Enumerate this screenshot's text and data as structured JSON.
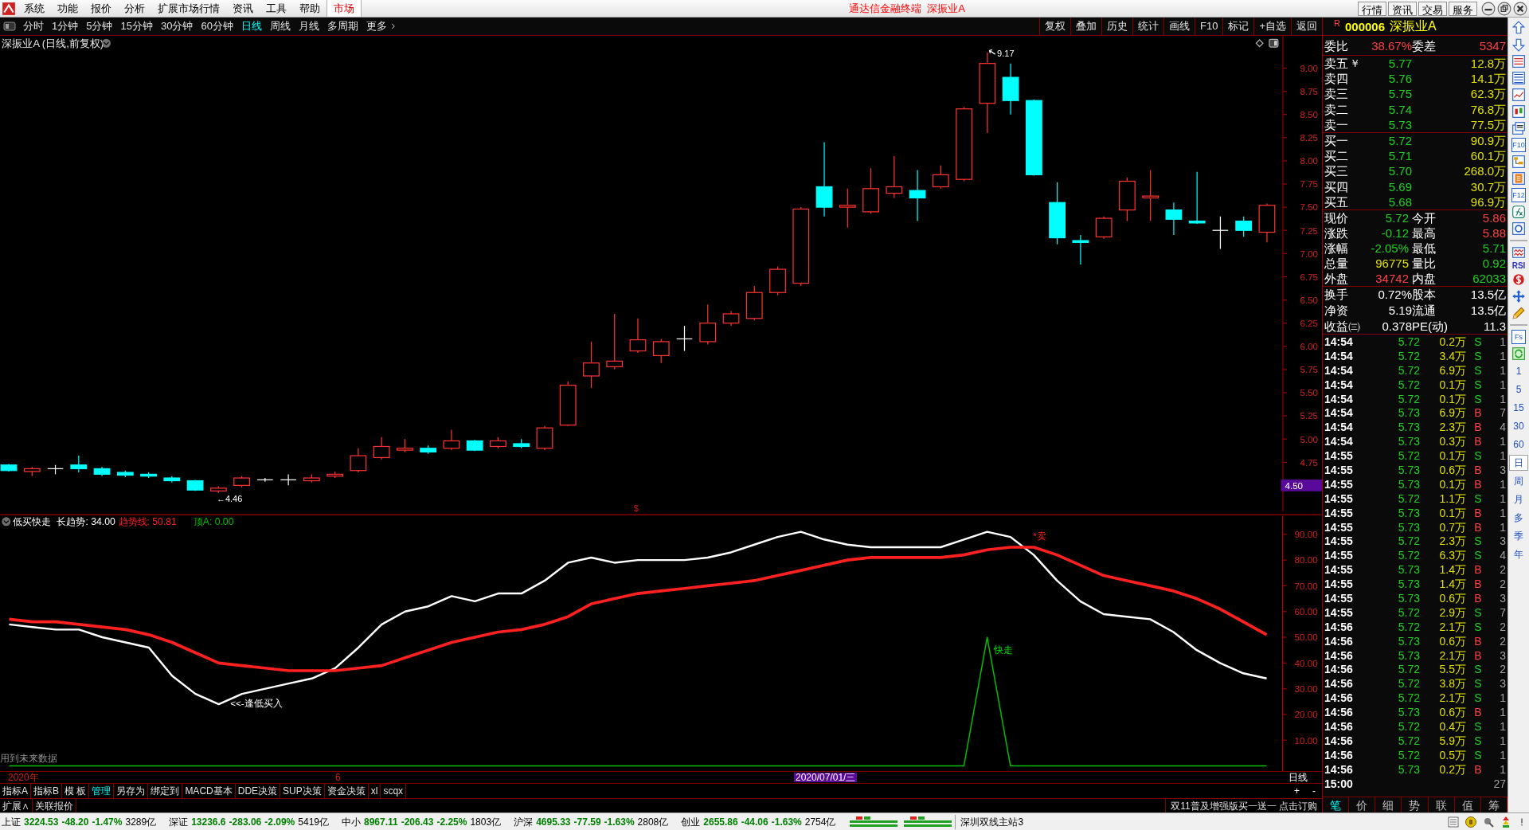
{
  "title_bar": {
    "menu": [
      "系统",
      "功能",
      "报价",
      "分析",
      "扩展市场行情",
      "资讯",
      "工具",
      "帮助"
    ],
    "market_tab": "市场",
    "title": "通达信金融终端  深振业A",
    "buttons": [
      "行情",
      "资讯",
      "交易",
      "服务"
    ]
  },
  "period_tabs": [
    {
      "label": "分时",
      "selected": false
    },
    {
      "label": "1分钟",
      "selected": false
    },
    {
      "label": "5分钟",
      "selected": false
    },
    {
      "label": "15分钟",
      "selected": false
    },
    {
      "label": "30分钟",
      "selected": false
    },
    {
      "label": "60分钟",
      "selected": false
    },
    {
      "label": "日线",
      "selected": true
    },
    {
      "label": "周线",
      "selected": false
    },
    {
      "label": "月线",
      "selected": false
    },
    {
      "label": "多周期",
      "selected": false
    },
    {
      "label": "更多",
      "selected": false
    }
  ],
  "chart_tools": [
    "复权",
    "叠加",
    "历史",
    "统计",
    "画线",
    "F10",
    "标记",
    "+自选",
    "返回"
  ],
  "price_chart": {
    "title": "深振业A (日线,前复权)",
    "y_labels": [
      "9.00",
      "8.75",
      "8.50",
      "8.25",
      "8.00",
      "7.75",
      "7.50",
      "7.25",
      "7.00",
      "6.75",
      "6.50",
      "6.25",
      "6.00",
      "5.75",
      "5.50",
      "5.25",
      "5.00",
      "4.75"
    ],
    "price_marker": "4.50",
    "high_label": "9.17",
    "low_label": "←4.46",
    "signal_mark": "$"
  },
  "indicator": {
    "name": "低买快走",
    "buy_label": "<<-逢低买入",
    "sell_label": "*卖",
    "exit_label": "快走",
    "footnote": "用到未来数据",
    "chart_data": {
      "type": "line",
      "ylim": [
        -2,
        98
      ],
      "yticks": [
        {
          "value": 90,
          "label": "90.00"
        },
        {
          "value": 80,
          "label": "80.00"
        },
        {
          "value": 70,
          "label": "70.00"
        },
        {
          "value": 60,
          "label": "60.00"
        },
        {
          "value": 50,
          "label": "50.00"
        },
        {
          "value": 40,
          "label": "40.00"
        },
        {
          "value": 30,
          "label": "30.00"
        },
        {
          "value": 20,
          "label": "20.00"
        },
        {
          "value": 10,
          "label": "10.00"
        }
      ],
      "series": [
        {
          "name": "长趋势: 34.00",
          "color": "#ffffff",
          "values": [
            55,
            54,
            53,
            53,
            50,
            48,
            46,
            35,
            28,
            24,
            28,
            30,
            32,
            34,
            38,
            46,
            55,
            60,
            62,
            66,
            64,
            67,
            67,
            72,
            79,
            81,
            79,
            80,
            80,
            80,
            81,
            83,
            86,
            89,
            91,
            88,
            86,
            85,
            85,
            85,
            85,
            88,
            91,
            89,
            82,
            72,
            64,
            59,
            58,
            57,
            52,
            45,
            40,
            36,
            34
          ]
        },
        {
          "name": "趋势线: 50.81",
          "color": "#ff2020",
          "values": [
            57,
            56,
            56,
            55,
            54,
            53,
            51,
            48,
            44,
            40,
            39,
            38,
            37,
            37,
            37,
            38,
            39,
            42,
            45,
            48,
            50,
            52,
            53,
            55,
            58,
            63,
            65,
            67,
            68,
            69,
            70,
            71,
            72,
            74,
            76,
            78,
            80,
            81,
            81,
            81,
            81,
            82,
            84,
            85,
            85,
            82,
            78,
            74,
            72,
            70,
            68,
            65,
            61,
            56,
            51
          ]
        },
        {
          "name": "顶A: 0.00",
          "color": "#00c000",
          "values": [
            0,
            0,
            0,
            0,
            0,
            0,
            0,
            0,
            0,
            0,
            0,
            0,
            0,
            0,
            0,
            0,
            0,
            0,
            0,
            0,
            0,
            0,
            0,
            0,
            0,
            0,
            0,
            0,
            0,
            0,
            0,
            0,
            0,
            0,
            0,
            0,
            0,
            0,
            0,
            0,
            0,
            0,
            50,
            0,
            0,
            0,
            0,
            0,
            0,
            0,
            0,
            0,
            0,
            0,
            0
          ]
        }
      ]
    }
  },
  "date_axis": {
    "year": "2020年",
    "month": "6",
    "cursor_date": "2020/07/01/三",
    "period": "日线",
    "zoom_in": "+",
    "zoom_out": "-"
  },
  "indicator_tabs": [
    {
      "label": "指标A",
      "selected": false
    },
    {
      "label": "指标B",
      "selected": false
    },
    {
      "label": "模 板",
      "selected": false
    },
    {
      "label": "管理",
      "selected": true
    },
    {
      "label": "另存为",
      "selected": false
    },
    {
      "label": "绑定到",
      "selected": false
    },
    {
      "label": "MACD基本",
      "selected": false
    },
    {
      "label": "DDE决策",
      "selected": false
    },
    {
      "label": "SUP决策",
      "selected": false
    },
    {
      "label": "资金决策",
      "selected": false
    },
    {
      "label": "xl",
      "selected": false
    },
    {
      "label": "scqx",
      "selected": false
    }
  ],
  "extra_tabs": [
    "扩展∧",
    "关联报价"
  ],
  "promo": "双11普及增强版买一送一 点击订购",
  "quote": {
    "badge": "R",
    "code": "000006",
    "name": "深振业A",
    "ratio": {
      "label": "委比",
      "value": "38.67%",
      "label2": "委差",
      "value2": "5347"
    },
    "currency_mark": "￥",
    "asks": [
      {
        "label": "卖五",
        "price": "5.77",
        "volume": "12.8万"
      },
      {
        "label": "卖四",
        "price": "5.76",
        "volume": "14.1万"
      },
      {
        "label": "卖三",
        "price": "5.75",
        "volume": "62.3万"
      },
      {
        "label": "卖二",
        "price": "5.74",
        "volume": "76.8万"
      },
      {
        "label": "卖一",
        "price": "5.73",
        "volume": "77.5万"
      }
    ],
    "bids": [
      {
        "label": "买一",
        "price": "5.72",
        "volume": "90.9万"
      },
      {
        "label": "买二",
        "price": "5.71",
        "volume": "60.1万"
      },
      {
        "label": "买三",
        "price": "5.70",
        "volume": "268.0万"
      },
      {
        "label": "买四",
        "price": "5.69",
        "volume": "30.7万"
      },
      {
        "label": "买五",
        "price": "5.68",
        "volume": "96.9万"
      }
    ],
    "stats": [
      {
        "label": "现价",
        "value": "5.72",
        "color": "#20d020"
      },
      {
        "label": "今开",
        "value": "5.86",
        "color": "#ff4040"
      },
      {
        "label": "涨跌",
        "value": "-0.12",
        "color": "#20d020"
      },
      {
        "label": "最高",
        "value": "5.88",
        "color": "#ff4040"
      },
      {
        "label": "涨幅",
        "value": "-2.05%",
        "color": "#20d020"
      },
      {
        "label": "最低",
        "value": "5.71",
        "color": "#20d020"
      },
      {
        "label": "总量",
        "value": "96775",
        "color": "#e0e000"
      },
      {
        "label": "量比",
        "value": "0.92",
        "color": "#20d020"
      },
      {
        "label": "外盘",
        "value": "34742",
        "color": "#ff4040"
      },
      {
        "label": "内盘",
        "value": "62033",
        "color": "#20d020"
      }
    ],
    "fundamentals": [
      {
        "label": "换手",
        "value": "0.72%",
        "label2": "股本",
        "value2": "13.5亿"
      },
      {
        "label": "净资",
        "value": "5.19",
        "label2": "流通",
        "value2": "13.5亿"
      },
      {
        "label": "收益㈢",
        "value": "0.378",
        "label2": "PE(动)",
        "value2": "11.3"
      }
    ],
    "trades": [
      {
        "time": "14:54",
        "price": "5.72",
        "volume": "0.2万",
        "side": "S",
        "kind": "sell",
        "count": "1"
      },
      {
        "time": "14:54",
        "price": "5.72",
        "volume": "3.4万",
        "side": "S",
        "kind": "sell",
        "count": "1"
      },
      {
        "time": "14:54",
        "price": "5.72",
        "volume": "6.9万",
        "side": "S",
        "kind": "sell",
        "count": "1"
      },
      {
        "time": "14:54",
        "price": "5.72",
        "volume": "0.1万",
        "side": "S",
        "kind": "sell",
        "count": "1"
      },
      {
        "time": "14:54",
        "price": "5.72",
        "volume": "0.1万",
        "side": "S",
        "kind": "sell",
        "count": "1"
      },
      {
        "time": "14:54",
        "price": "5.73",
        "volume": "6.9万",
        "side": "B",
        "kind": "buy",
        "count": "7"
      },
      {
        "time": "14:54",
        "price": "5.73",
        "volume": "2.3万",
        "side": "B",
        "kind": "buy",
        "count": "4"
      },
      {
        "time": "14:54",
        "price": "5.73",
        "volume": "0.3万",
        "side": "B",
        "kind": "buy",
        "count": "1"
      },
      {
        "time": "14:55",
        "price": "5.72",
        "volume": "0.1万",
        "side": "S",
        "kind": "sell",
        "count": "1"
      },
      {
        "time": "14:55",
        "price": "5.73",
        "volume": "0.6万",
        "side": "B",
        "kind": "buy",
        "count": "3"
      },
      {
        "time": "14:55",
        "price": "5.73",
        "volume": "0.1万",
        "side": "B",
        "kind": "buy",
        "count": "1"
      },
      {
        "time": "14:55",
        "price": "5.72",
        "volume": "1.1万",
        "side": "S",
        "kind": "sell",
        "count": "1"
      },
      {
        "time": "14:55",
        "price": "5.73",
        "volume": "0.1万",
        "side": "B",
        "kind": "buy",
        "count": "1"
      },
      {
        "time": "14:55",
        "price": "5.73",
        "volume": "0.7万",
        "side": "B",
        "kind": "buy",
        "count": "1"
      },
      {
        "time": "14:55",
        "price": "5.72",
        "volume": "2.3万",
        "side": "S",
        "kind": "sell",
        "count": "3"
      },
      {
        "time": "14:55",
        "price": "5.72",
        "volume": "6.3万",
        "side": "S",
        "kind": "sell",
        "count": "4"
      },
      {
        "time": "14:55",
        "price": "5.73",
        "volume": "1.4万",
        "side": "B",
        "kind": "buy",
        "count": "2"
      },
      {
        "time": "14:55",
        "price": "5.73",
        "volume": "1.4万",
        "side": "B",
        "kind": "buy",
        "count": "2"
      },
      {
        "time": "14:55",
        "price": "5.73",
        "volume": "0.6万",
        "side": "B",
        "kind": "buy",
        "count": "3"
      },
      {
        "time": "14:55",
        "price": "5.72",
        "volume": "2.9万",
        "side": "S",
        "kind": "sell",
        "count": "7"
      },
      {
        "time": "14:56",
        "price": "5.72",
        "volume": "2.1万",
        "side": "S",
        "kind": "sell",
        "count": "2"
      },
      {
        "time": "14:56",
        "price": "5.73",
        "volume": "0.6万",
        "side": "B",
        "kind": "buy",
        "count": "2"
      },
      {
        "time": "14:56",
        "price": "5.73",
        "volume": "2.1万",
        "side": "B",
        "kind": "buy",
        "count": "3"
      },
      {
        "time": "14:56",
        "price": "5.72",
        "volume": "5.5万",
        "side": "S",
        "kind": "sell",
        "count": "2"
      },
      {
        "time": "14:56",
        "price": "5.72",
        "volume": "3.8万",
        "side": "S",
        "kind": "sell",
        "count": "3"
      },
      {
        "time": "14:56",
        "price": "5.72",
        "volume": "2.1万",
        "side": "S",
        "kind": "sell",
        "count": "1"
      },
      {
        "time": "14:56",
        "price": "5.73",
        "volume": "0.6万",
        "side": "B",
        "kind": "buy",
        "count": "1"
      },
      {
        "time": "14:56",
        "price": "5.72",
        "volume": "0.4万",
        "side": "S",
        "kind": "sell",
        "count": "1"
      },
      {
        "time": "14:56",
        "price": "5.72",
        "volume": "5.9万",
        "side": "S",
        "kind": "sell",
        "count": "1"
      },
      {
        "time": "14:56",
        "price": "5.72",
        "volume": "0.5万",
        "side": "S",
        "kind": "sell",
        "count": "1"
      },
      {
        "time": "14:56",
        "price": "5.73",
        "volume": "0.2万",
        "side": "B",
        "kind": "buy",
        "count": "1"
      },
      {
        "time": "15:00",
        "count": "27"
      }
    ],
    "detail_tabs": [
      {
        "label": "笔",
        "selected": true
      },
      {
        "label": "价",
        "selected": false
      },
      {
        "label": "细",
        "selected": false
      },
      {
        "label": "势",
        "selected": false
      },
      {
        "label": "联",
        "selected": false
      },
      {
        "label": "值",
        "selected": false
      },
      {
        "label": "筹",
        "selected": false
      }
    ]
  },
  "side_tools": [
    {
      "kind": "up"
    },
    {
      "kind": "down"
    },
    {
      "kind": "sheet"
    },
    {
      "kind": "table"
    },
    {
      "kind": "trend"
    },
    {
      "kind": "candle"
    },
    {
      "kind": "window"
    },
    {
      "kind": "boxed",
      "label": "F10"
    },
    {
      "kind": "tree"
    },
    {
      "kind": "note"
    },
    {
      "kind": "boxed",
      "label": "F12"
    },
    {
      "kind": "fx"
    },
    {
      "kind": "circle"
    },
    {
      "kind": "divider"
    },
    {
      "kind": "wave"
    },
    {
      "kind": "text",
      "label": "RSI"
    },
    {
      "kind": "dollar"
    },
    {
      "kind": "move"
    },
    {
      "kind": "pencil"
    },
    {
      "kind": "divider"
    },
    {
      "kind": "boxed",
      "label": "Fs"
    },
    {
      "kind": "refresh"
    }
  ],
  "side_periods": [
    {
      "label": "1",
      "selected": false
    },
    {
      "label": "5",
      "selected": false
    },
    {
      "label": "15",
      "selected": false
    },
    {
      "label": "30",
      "selected": false
    },
    {
      "label": "60",
      "selected": false
    },
    {
      "label": "日",
      "selected": true
    },
    {
      "label": "周",
      "selected": false
    },
    {
      "label": "月",
      "selected": false
    },
    {
      "label": "多",
      "selected": false
    },
    {
      "label": "季",
      "selected": false
    },
    {
      "label": "年",
      "selected": false
    }
  ],
  "status_bar": {
    "indices": [
      {
        "name": "上证",
        "value": "3224.53",
        "change": "-48.20",
        "pct": "-1.47%",
        "amount": "3289亿"
      },
      {
        "name": "深证",
        "value": "13236.6",
        "change": "-283.06",
        "pct": "-2.09%",
        "amount": "5419亿"
      },
      {
        "name": "中小",
        "value": "8967.11",
        "change": "-206.43",
        "pct": "-2.25%",
        "amount": "1803亿"
      },
      {
        "name": "沪深",
        "value": "4695.33",
        "change": "-77.59",
        "pct": "-1.63%",
        "amount": "2808亿"
      },
      {
        "name": "创业",
        "value": "2655.86",
        "change": "-44.06",
        "pct": "-1.63%",
        "amount": "2754亿"
      }
    ],
    "server": "深圳双线主站3"
  }
}
